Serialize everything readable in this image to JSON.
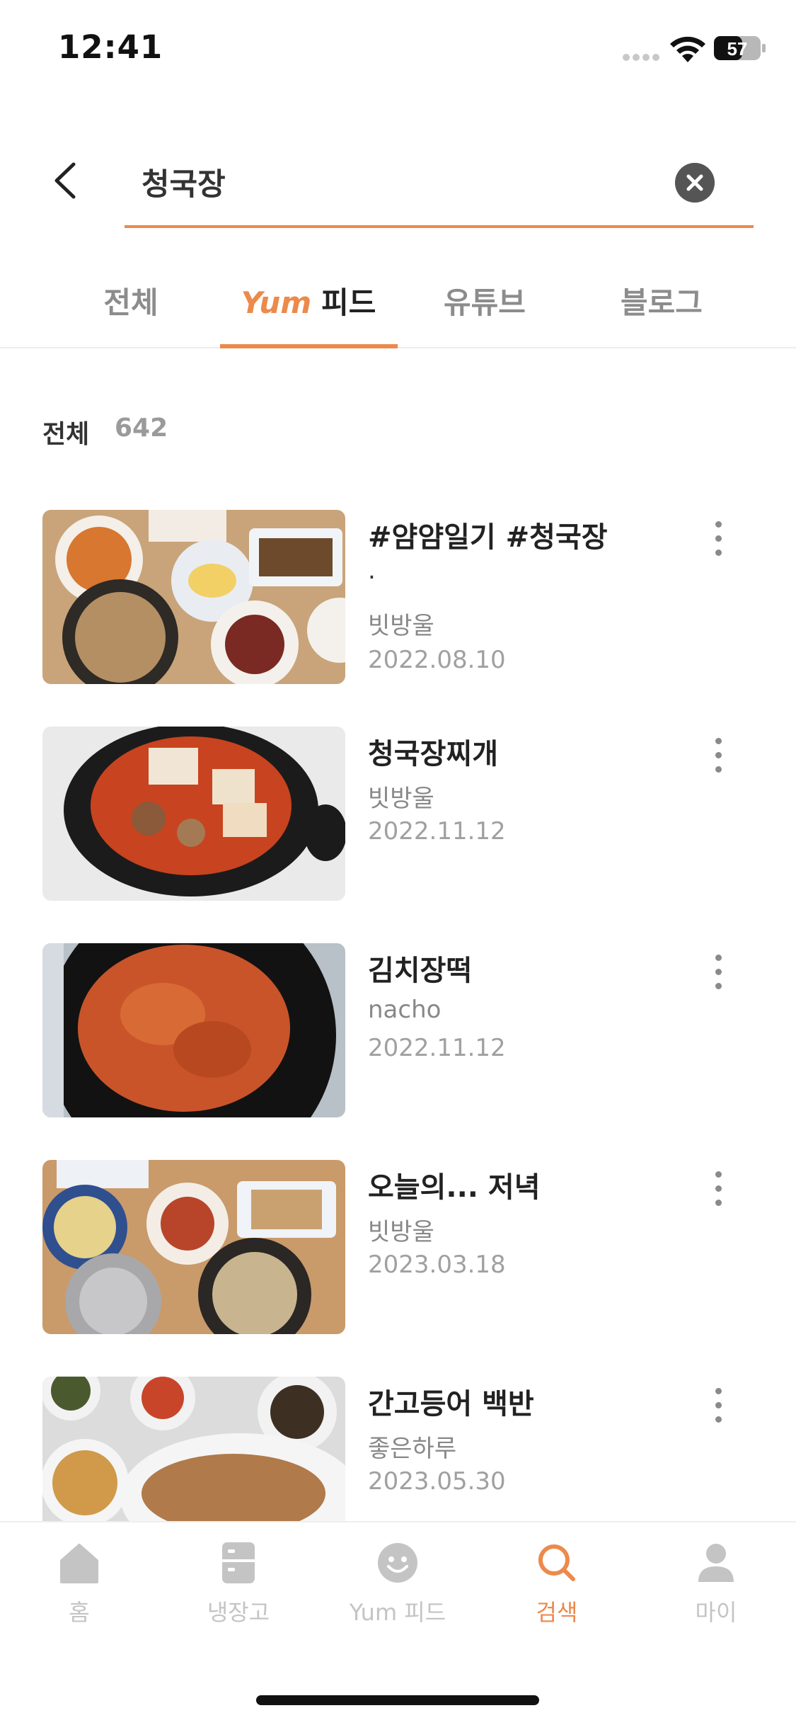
{
  "status_bar": {
    "time": "12:41",
    "battery": "57"
  },
  "search": {
    "query": "청국장"
  },
  "tabs": [
    {
      "label": "전체"
    },
    {
      "logo": "Yum",
      "label": "피드"
    },
    {
      "label": "유튜브"
    },
    {
      "label": "블로그"
    }
  ],
  "results": {
    "label": "전체",
    "count": "642"
  },
  "items": [
    {
      "title": "#얌얌일기 #청국장",
      "extra": ".",
      "author": "빗방울",
      "date": "2022.08.10"
    },
    {
      "title": "청국장찌개",
      "author": "빗방울",
      "date": "2022.11.12"
    },
    {
      "title": "김치장떡",
      "author": "nacho",
      "date": "2022.11.12"
    },
    {
      "title": "오늘의... 저녁",
      "author": "빗방울",
      "date": "2023.03.18"
    },
    {
      "title": "간고등어 백반",
      "author": "좋은하루",
      "date": "2023.05.30"
    }
  ],
  "nav": [
    {
      "label": "홈",
      "icon": "home-icon"
    },
    {
      "label": "냉장고",
      "icon": "fridge-icon"
    },
    {
      "label": "Yum 피드",
      "icon": "smile-icon"
    },
    {
      "label": "검색",
      "icon": "search-icon",
      "active": true
    },
    {
      "label": "마이",
      "icon": "person-icon"
    }
  ],
  "colors": {
    "accent": "#ec8a4c",
    "inactive": "#c4c4c4"
  }
}
